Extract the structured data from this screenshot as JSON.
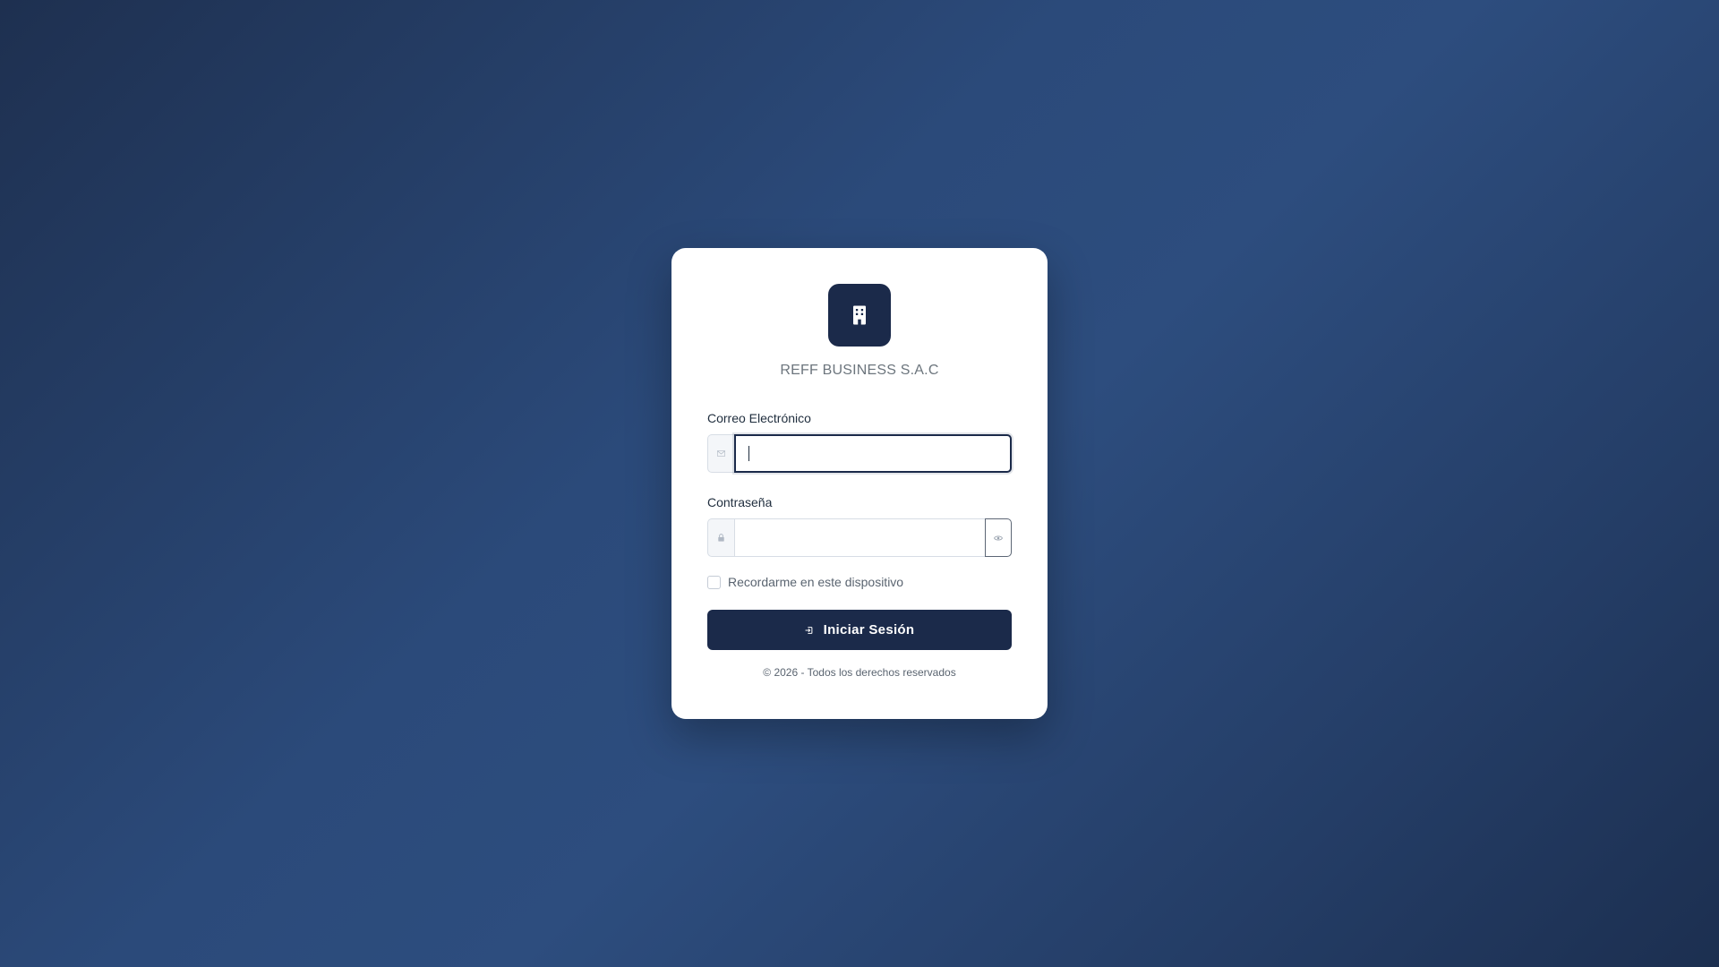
{
  "brand": {
    "company_name": "REFF BUSINESS S.A.C",
    "logo_icon": "building-icon"
  },
  "form": {
    "email": {
      "label": "Correo Electrónico",
      "value": "",
      "icon": "envelope-icon",
      "focused": true
    },
    "password": {
      "label": "Contraseña",
      "value": "",
      "icon": "lock-icon",
      "toggle_icon": "eye-icon"
    },
    "remember_label": "Recordarme en este dispositivo",
    "remember_checked": false,
    "submit_label": "Iniciar Sesión",
    "submit_icon": "sign-in-icon"
  },
  "footer": {
    "text": "© 2026 - Todos los derechos reservados"
  },
  "colors": {
    "primary": "#1b2a4a",
    "background_start": "#1e3050",
    "background_mid": "#2d4d7e",
    "muted_text": "#6c757d"
  }
}
